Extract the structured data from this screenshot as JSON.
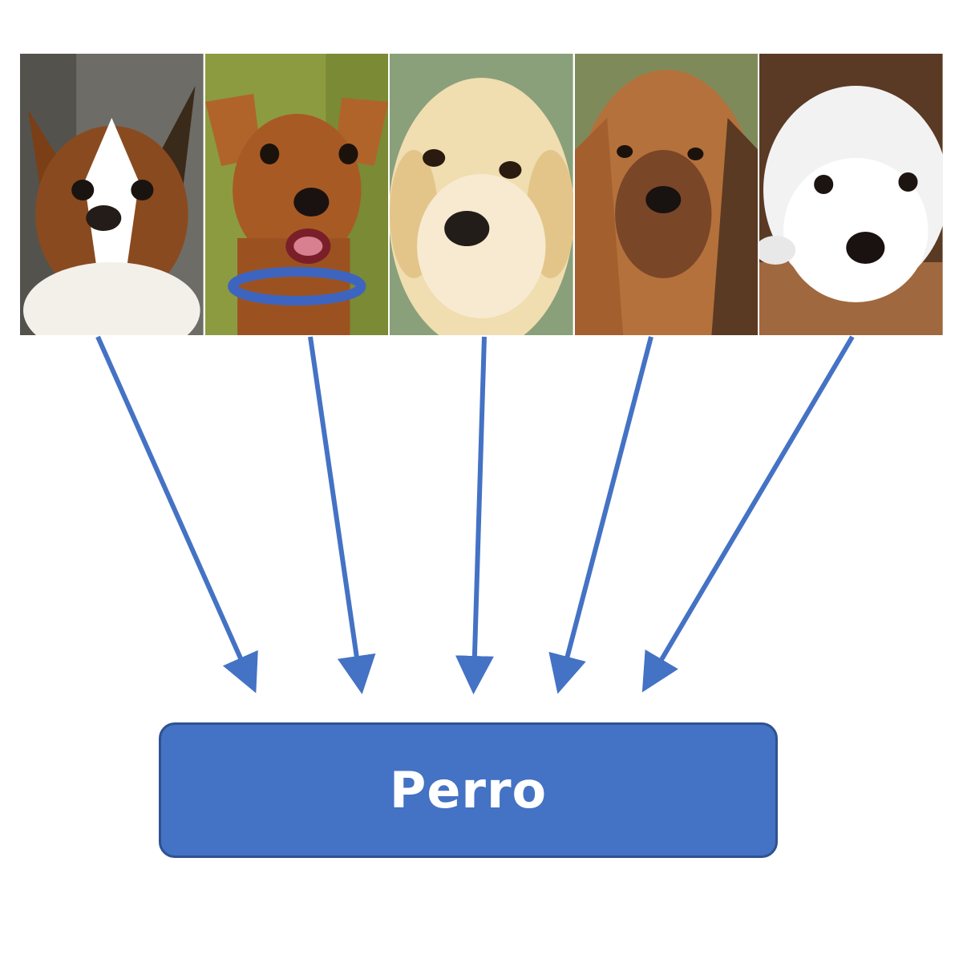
{
  "diagram": {
    "label": "Perro",
    "colors": {
      "arrow": "#4472c4",
      "box_fill": "#4472c4",
      "box_border": "#2f528f",
      "label_text": "#ffffff"
    },
    "photos": [
      {
        "name": "papillon-dog-photo",
        "fur": "#8a4a1f",
        "face": "#ffffff",
        "bg": "#6b6b66"
      },
      {
        "name": "pinscher-dog-photo",
        "fur": "#a85a24",
        "face": "#b8682c",
        "bg": "#8a9a3c"
      },
      {
        "name": "golden-puppy-photo",
        "fur": "#f3e2b8",
        "face": "#f7ead0",
        "bg": "#8aa07a"
      },
      {
        "name": "terrier-dog-photo",
        "fur": "#b5713b",
        "face": "#8a5230",
        "bg": "#7f8a5a"
      },
      {
        "name": "maltese-dog-photo",
        "fur": "#f2f2f2",
        "face": "#ffffff",
        "bg": "#5a3a24"
      }
    ]
  }
}
